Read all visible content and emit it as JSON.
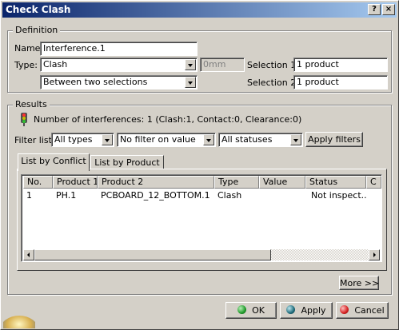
{
  "window": {
    "title": "Check Clash",
    "help_label": "?",
    "close_label": "×"
  },
  "definition": {
    "legend": "Definition",
    "name_label": "Name:",
    "name_value": "Interference.1",
    "type_label": "Type:",
    "type_value": "Clash",
    "clearance_value": "0mm",
    "mode_value": "Between two selections",
    "selection1_label": "Selection 1:",
    "selection1_value": "1 product",
    "selection2_label": "Selection 2:",
    "selection2_value": "1 product"
  },
  "results": {
    "legend": "Results",
    "summary": "Number of interferences: 1 (Clash:1, Contact:0, Clearance:0)",
    "filter_label": "Filter list:",
    "filter_type": "All types",
    "filter_value": "No filter on value",
    "filter_status": "All statuses",
    "apply_filters_label": "Apply filters",
    "tabs": [
      {
        "label": "List by Conflict",
        "active": true
      },
      {
        "label": "List by Product",
        "active": false
      }
    ],
    "columns": [
      "No.",
      "Product 1",
      "Product 2",
      "Type",
      "Value",
      "Status",
      "C"
    ],
    "rows": [
      {
        "no": "1",
        "product1": "PH.1",
        "product2": "PCBOARD_12_BOTTOM.1",
        "type": "Clash",
        "value": "",
        "status": "Not inspect..."
      }
    ],
    "more_label": "More >>"
  },
  "footer": {
    "ok_label": "OK",
    "apply_label": "Apply",
    "cancel_label": "Cancel"
  },
  "colors": {
    "ok_dot": "#1f9a2a",
    "apply_dot": "#1e6b7a",
    "cancel_dot": "#d42020"
  }
}
